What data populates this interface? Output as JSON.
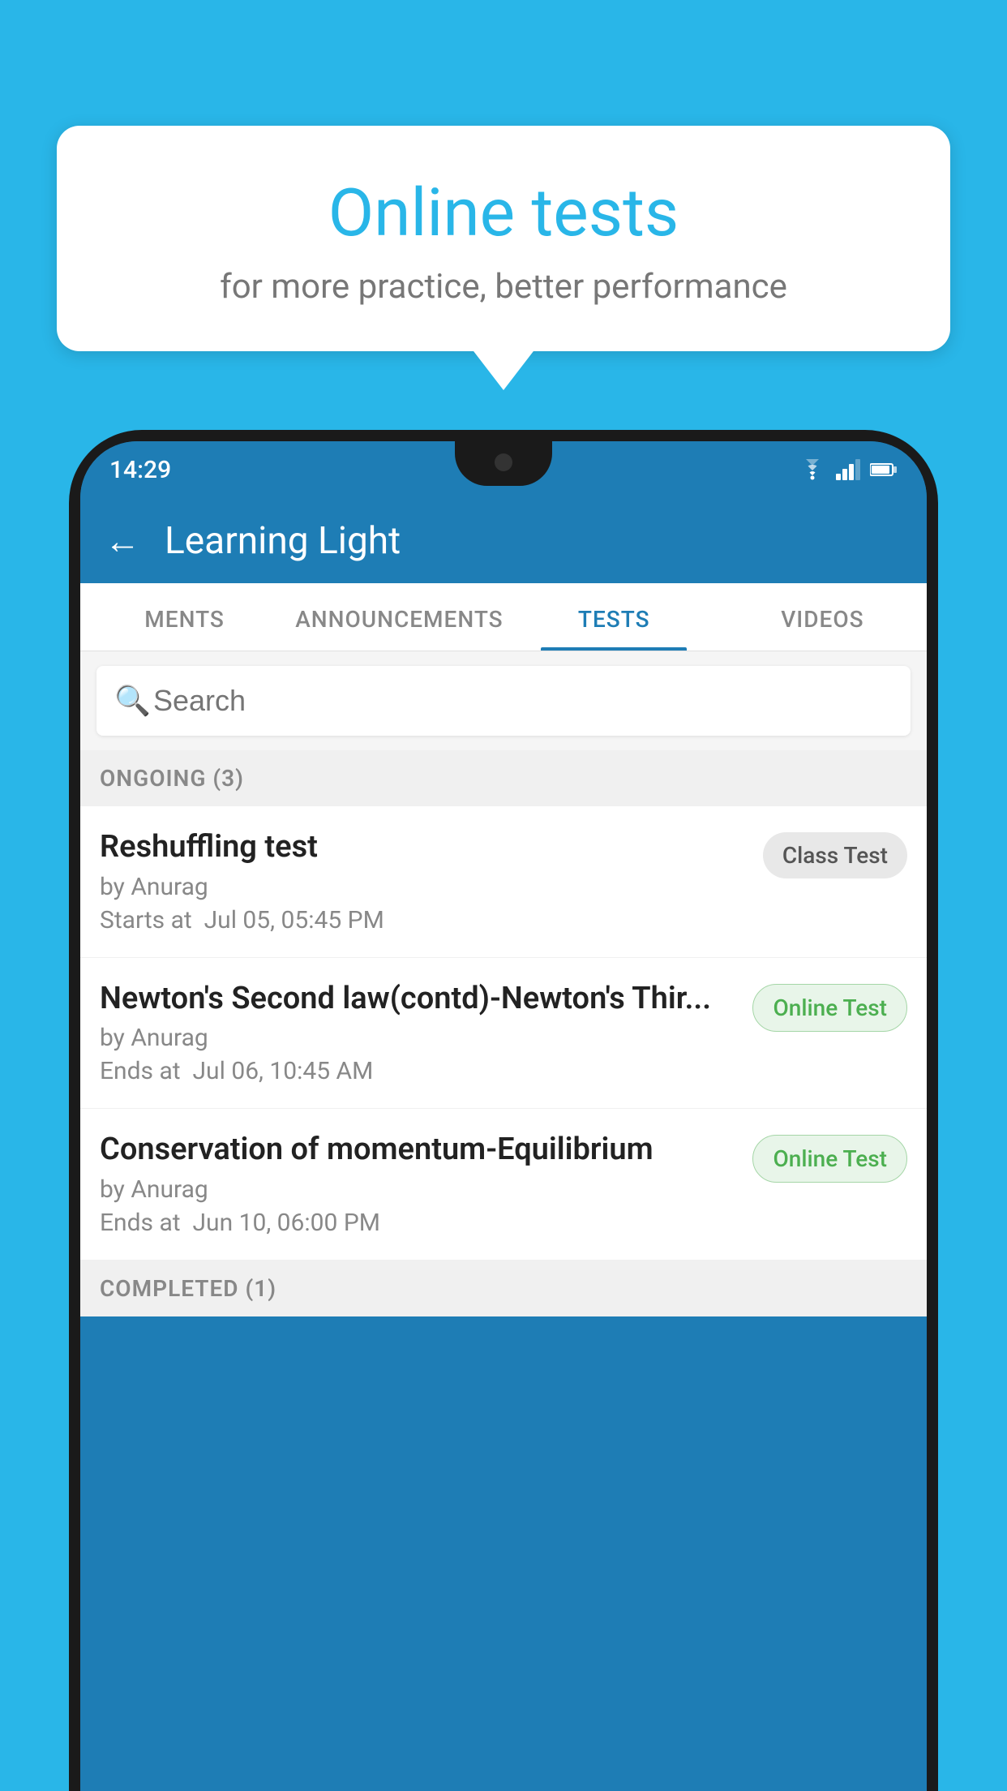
{
  "background_color": "#29b6e8",
  "speech_bubble": {
    "title": "Online tests",
    "subtitle": "for more practice, better performance"
  },
  "phone": {
    "status_bar": {
      "time": "14:29"
    },
    "app_header": {
      "title": "Learning Light"
    },
    "tabs": [
      {
        "label": "MENTS",
        "active": false
      },
      {
        "label": "ANNOUNCEMENTS",
        "active": false
      },
      {
        "label": "TESTS",
        "active": true
      },
      {
        "label": "VIDEOS",
        "active": false
      }
    ],
    "search": {
      "placeholder": "Search"
    },
    "ongoing_section": {
      "label": "ONGOING (3)"
    },
    "tests": [
      {
        "name": "Reshuffling test",
        "author": "by Anurag",
        "time_label": "Starts at",
        "time": "Jul 05, 05:45 PM",
        "badge": "Class Test",
        "badge_type": "class"
      },
      {
        "name": "Newton's Second law(contd)-Newton's Thir...",
        "author": "by Anurag",
        "time_label": "Ends at",
        "time": "Jul 06, 10:45 AM",
        "badge": "Online Test",
        "badge_type": "online"
      },
      {
        "name": "Conservation of momentum-Equilibrium",
        "author": "by Anurag",
        "time_label": "Ends at",
        "time": "Jun 10, 06:00 PM",
        "badge": "Online Test",
        "badge_type": "online"
      }
    ],
    "completed_section": {
      "label": "COMPLETED (1)"
    }
  }
}
